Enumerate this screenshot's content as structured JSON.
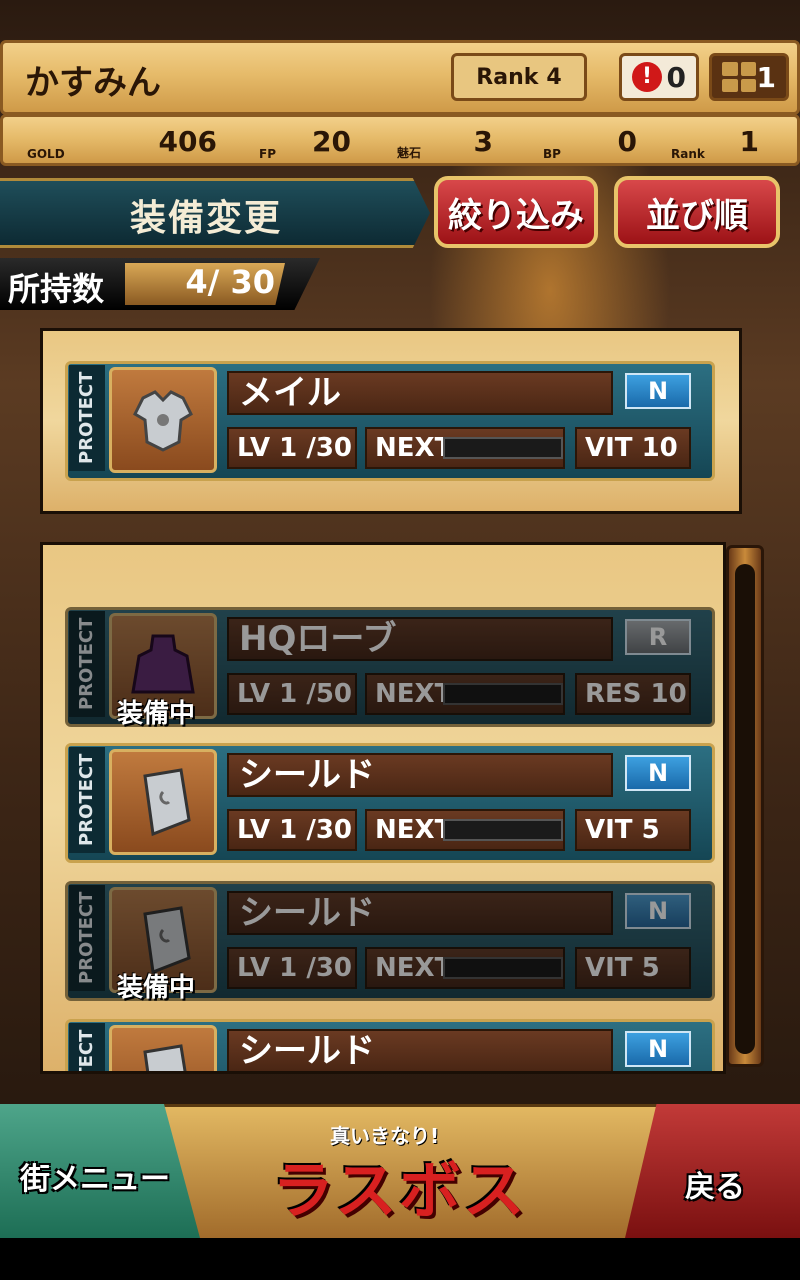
{
  "player": {
    "name": "かすみん",
    "rank_label": "Rank",
    "rank_value": "4",
    "alerts": "0",
    "boxes": "1"
  },
  "resources": [
    {
      "label": "GOLD",
      "value": "406"
    },
    {
      "label": "FP",
      "value": "20"
    },
    {
      "label": "魅石",
      "value": "3"
    },
    {
      "label": "BP",
      "value": "0"
    },
    {
      "label": "Rank",
      "value": "1"
    }
  ],
  "header": {
    "title": "装備変更",
    "filter_label": "絞り込み",
    "sort_label": "並び順"
  },
  "owned": {
    "label": "所持数",
    "value": "4/ 30"
  },
  "selected": {
    "protect": "PROTECT",
    "name": "メイル",
    "rarity": "N",
    "lv": "LV 1",
    "lv_max": "/30",
    "next": "NEXT",
    "stat": "VIT 10",
    "icon": "armor-icon"
  },
  "items": [
    {
      "protect": "PROTECT",
      "name": "HQローブ",
      "rarity": "R",
      "lv": "LV 1",
      "lv_max": "/50",
      "next": "NEXT",
      "stat": "RES 10",
      "equipped": "装備中",
      "icon": "robe-icon"
    },
    {
      "protect": "PROTECT",
      "name": "シールド",
      "rarity": "N",
      "lv": "LV 1",
      "lv_max": "/30",
      "next": "NEXT",
      "stat": "VIT 5",
      "equipped": "",
      "icon": "shield-icon"
    },
    {
      "protect": "PROTECT",
      "name": "シールド",
      "rarity": "N",
      "lv": "LV 1",
      "lv_max": "/30",
      "next": "NEXT",
      "stat": "VIT 5",
      "equipped": "装備中",
      "icon": "shield-icon"
    },
    {
      "protect": "PROTECT",
      "name": "シールド",
      "rarity": "N",
      "icon": "shield-icon"
    }
  ],
  "nav": {
    "town_menu": "街メニュー",
    "logo_top": "真いきなり!",
    "logo": "ラスボス",
    "back": "戻る"
  }
}
